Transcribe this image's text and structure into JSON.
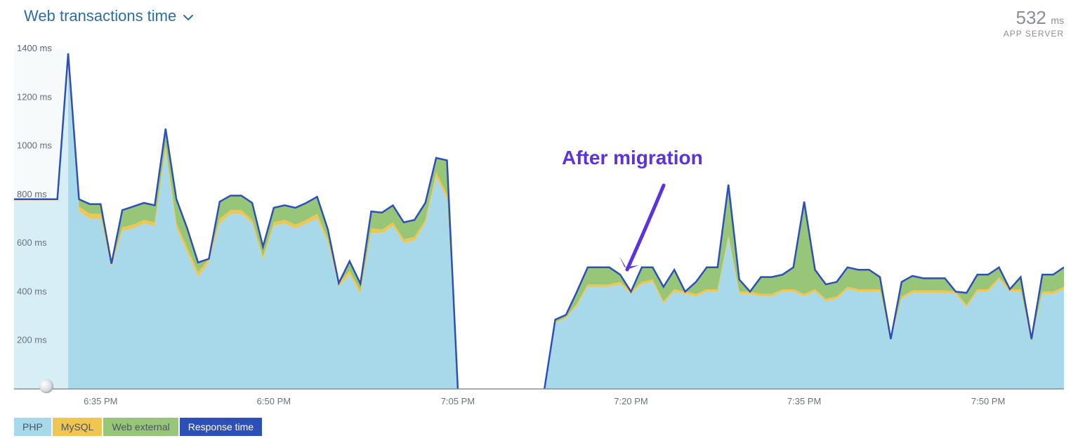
{
  "header": {
    "title": "Web transactions time",
    "metric_value": "532",
    "metric_unit": "ms",
    "metric_label": "APP SERVER"
  },
  "legend": {
    "php": "PHP",
    "mysql": "MySQL",
    "ext": "Web external",
    "resp": "Response time"
  },
  "annotation": {
    "text": "After migration"
  },
  "chart_data": {
    "type": "area",
    "title": "Web transactions time",
    "ylabel": "ms",
    "ylim": [
      0,
      1400
    ],
    "y_ticks": [
      200,
      400,
      600,
      800,
      1000,
      1200,
      1400
    ],
    "x_ticks": [
      "6:35 PM",
      "6:50 PM",
      "7:05 PM",
      "7:20 PM",
      "7:35 PM",
      "7:50 PM"
    ],
    "stack_order_bottom_to_top": [
      "PHP",
      "MySQL",
      "Web external"
    ],
    "response_time_is_line_on_top": true,
    "gap_note": "downtime / no data roughly 7:03 PM – 7:10 PM",
    "annotation": {
      "text": "After migration",
      "points_to_time": "7:17 PM"
    },
    "series": [
      {
        "name": "PHP",
        "values": [
          770,
          770,
          770,
          770,
          770,
          1320,
          730,
          700,
          700,
          500,
          650,
          660,
          680,
          670,
          980,
          660,
          560,
          460,
          520,
          680,
          720,
          720,
          680,
          530,
          670,
          680,
          660,
          680,
          700,
          600,
          420,
          470,
          388,
          640,
          640,
          670,
          600,
          610,
          680,
          870,
          780,
          0,
          0,
          0,
          0,
          0,
          0,
          0,
          0,
          0,
          270,
          290,
          340,
          420,
          420,
          420,
          430,
          390,
          430,
          440,
          350,
          400,
          390,
          380,
          400,
          400,
          620,
          390,
          390,
          380,
          380,
          400,
          400,
          380,
          400,
          360,
          370,
          410,
          400,
          400,
          400,
          200,
          370,
          395,
          395,
          395,
          395,
          390,
          335,
          400,
          400,
          450,
          400,
          400,
          190,
          390,
          390,
          410
        ]
      },
      {
        "name": "MySQL",
        "values": [
          10,
          10,
          10,
          10,
          10,
          20,
          20,
          20,
          20,
          15,
          15,
          15,
          15,
          15,
          20,
          20,
          20,
          20,
          15,
          20,
          15,
          15,
          15,
          15,
          15,
          15,
          15,
          15,
          20,
          15,
          15,
          15,
          15,
          20,
          15,
          15,
          15,
          15,
          15,
          20,
          20,
          0,
          0,
          0,
          0,
          0,
          0,
          0,
          0,
          0,
          5,
          5,
          10,
          10,
          10,
          10,
          10,
          10,
          10,
          10,
          10,
          10,
          10,
          10,
          10,
          10,
          10,
          10,
          10,
          10,
          10,
          10,
          10,
          10,
          10,
          10,
          10,
          10,
          10,
          10,
          10,
          5,
          10,
          10,
          10,
          10,
          10,
          10,
          10,
          10,
          10,
          10,
          10,
          10,
          5,
          10,
          10,
          10
        ]
      },
      {
        "name": "Web external",
        "values": [
          0,
          0,
          0,
          0,
          0,
          40,
          30,
          40,
          40,
          0,
          70,
          75,
          70,
          70,
          70,
          100,
          80,
          40,
          0,
          70,
          60,
          60,
          70,
          40,
          60,
          60,
          70,
          70,
          70,
          40,
          0,
          40,
          30,
          70,
          70,
          70,
          70,
          70,
          70,
          60,
          140,
          0,
          0,
          0,
          0,
          0,
          0,
          0,
          0,
          0,
          10,
          10,
          50,
          70,
          70,
          70,
          30,
          0,
          60,
          50,
          60,
          80,
          0,
          50,
          90,
          90,
          210,
          50,
          0,
          70,
          70,
          60,
          90,
          380,
          80,
          60,
          60,
          80,
          80,
          80,
          50,
          0,
          60,
          60,
          50,
          50,
          50,
          0,
          50,
          60,
          60,
          40,
          0,
          50,
          10,
          70,
          70,
          80
        ]
      },
      {
        "name": "Response time",
        "values": [
          780,
          780,
          780,
          780,
          780,
          1380,
          780,
          760,
          760,
          515,
          735,
          750,
          765,
          755,
          1070,
          780,
          660,
          520,
          535,
          770,
          795,
          795,
          765,
          585,
          745,
          755,
          745,
          765,
          790,
          655,
          435,
          525,
          433,
          730,
          725,
          755,
          685,
          695,
          765,
          950,
          940,
          0,
          0,
          0,
          0,
          0,
          0,
          0,
          0,
          0,
          285,
          305,
          400,
          500,
          500,
          500,
          470,
          400,
          500,
          500,
          420,
          490,
          400,
          440,
          500,
          500,
          840,
          450,
          400,
          460,
          460,
          470,
          500,
          770,
          490,
          430,
          440,
          500,
          490,
          490,
          460,
          205,
          440,
          465,
          455,
          455,
          455,
          400,
          395,
          470,
          470,
          500,
          410,
          460,
          205,
          470,
          470,
          500
        ]
      }
    ]
  }
}
